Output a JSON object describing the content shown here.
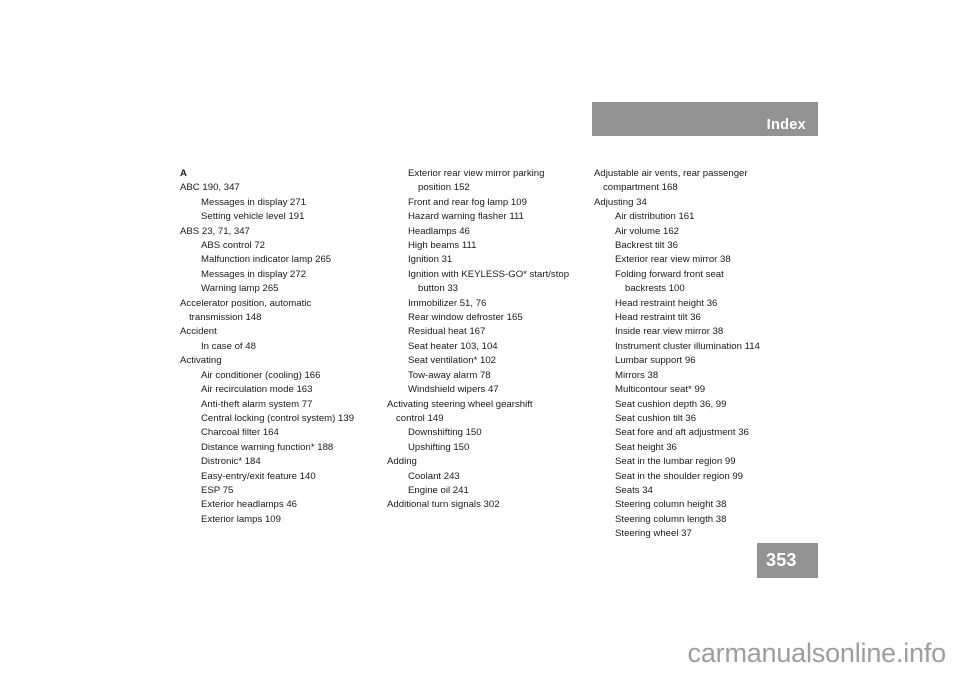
{
  "header": {
    "title": "Index"
  },
  "footer": {
    "page_number": "353",
    "watermark": "carmanualsonline.info"
  },
  "colors": {
    "band": "#939393",
    "band_text": "#ffffff",
    "body_text": "#1a1a1a",
    "watermark": "#9d9d9d",
    "page_background": "#ffffff"
  },
  "columns": [
    {
      "lines": [
        {
          "level": "heading",
          "text": "A"
        },
        {
          "level": 0,
          "text": "ABC    190, 347"
        },
        {
          "level": 1,
          "text": "Messages in display    271"
        },
        {
          "level": 1,
          "text": "Setting vehicle level    191"
        },
        {
          "level": 0,
          "text": "ABS    23, 71, 347"
        },
        {
          "level": 1,
          "text": "ABS control    72"
        },
        {
          "level": 1,
          "text": "Malfunction indicator lamp    265"
        },
        {
          "level": 1,
          "text": "Messages in display    272"
        },
        {
          "level": 1,
          "text": "Warning lamp    265"
        },
        {
          "level": 0,
          "text": "Accelerator position, automatic"
        },
        {
          "level": "0c",
          "text": "transmission    148"
        },
        {
          "level": 0,
          "text": "Accident"
        },
        {
          "level": 1,
          "text": "In case of    48"
        },
        {
          "level": 0,
          "text": "Activating"
        },
        {
          "level": 1,
          "text": "Air conditioner (cooling)    166"
        },
        {
          "level": 1,
          "text": "Air recirculation mode    163"
        },
        {
          "level": 1,
          "text": "Anti-theft alarm system    77"
        },
        {
          "level": 1,
          "text": "Central locking (control system)    139"
        },
        {
          "level": 1,
          "text": "Charcoal filter    164"
        },
        {
          "level": 1,
          "text": "Distance warning function*    188"
        },
        {
          "level": 1,
          "text": "Distronic*    184"
        },
        {
          "level": 1,
          "text": "Easy-entry/exit feature    140"
        },
        {
          "level": 1,
          "text": "ESP    75"
        },
        {
          "level": 1,
          "text": "Exterior headlamps    46"
        },
        {
          "level": 1,
          "text": "Exterior lamps    109"
        }
      ]
    },
    {
      "lines": [
        {
          "level": 1,
          "text": "Exterior rear view mirror parking"
        },
        {
          "level": "1c",
          "text": "position    152"
        },
        {
          "level": 1,
          "text": "Front and rear fog lamp    109"
        },
        {
          "level": 1,
          "text": "Hazard warning flasher    111"
        },
        {
          "level": 1,
          "text": "Headlamps    46"
        },
        {
          "level": 1,
          "text": "High beams    111"
        },
        {
          "level": 1,
          "text": "Ignition    31"
        },
        {
          "level": 1,
          "text": "Ignition with KEYLESS-GO* start/stop"
        },
        {
          "level": "1c",
          "text": "button    33"
        },
        {
          "level": 1,
          "text": "Immobilizer    51, 76"
        },
        {
          "level": 1,
          "text": "Rear window defroster    165"
        },
        {
          "level": 1,
          "text": "Residual heat    167"
        },
        {
          "level": 1,
          "text": "Seat heater    103, 104"
        },
        {
          "level": 1,
          "text": "Seat ventilation*    102"
        },
        {
          "level": 1,
          "text": "Tow-away alarm    78"
        },
        {
          "level": 1,
          "text": "Windshield wipers    47"
        },
        {
          "level": 0,
          "text": "Activating steering wheel gearshift"
        },
        {
          "level": "0c",
          "text": "control    149"
        },
        {
          "level": 1,
          "text": "Downshifting    150"
        },
        {
          "level": 1,
          "text": "Upshifting    150"
        },
        {
          "level": 0,
          "text": "Adding"
        },
        {
          "level": 1,
          "text": "Coolant    243"
        },
        {
          "level": 1,
          "text": "Engine oil    241"
        },
        {
          "level": 0,
          "text": "Additional turn signals    302"
        }
      ]
    },
    {
      "lines": [
        {
          "level": 0,
          "text": "Adjustable air vents, rear passenger"
        },
        {
          "level": "0c",
          "text": "compartment    168"
        },
        {
          "level": 0,
          "text": "Adjusting    34"
        },
        {
          "level": 1,
          "text": "Air distribution    161"
        },
        {
          "level": 1,
          "text": "Air volume    162"
        },
        {
          "level": 1,
          "text": "Backrest tilt    36"
        },
        {
          "level": 1,
          "text": "Exterior rear view mirror    38"
        },
        {
          "level": 1,
          "text": "Folding forward front seat"
        },
        {
          "level": "1c",
          "text": "backrests    100"
        },
        {
          "level": 1,
          "text": "Head restraint height    36"
        },
        {
          "level": 1,
          "text": "Head restraint tilt    36"
        },
        {
          "level": 1,
          "text": "Inside rear view mirror    38"
        },
        {
          "level": 1,
          "text": "Instrument cluster illumination    114"
        },
        {
          "level": 1,
          "text": "Lumbar support    96"
        },
        {
          "level": 1,
          "text": "Mirrors    38"
        },
        {
          "level": 1,
          "text": "Multicontour seat*    99"
        },
        {
          "level": 1,
          "text": "Seat cushion depth    36, 99"
        },
        {
          "level": 1,
          "text": "Seat cushion tilt    36"
        },
        {
          "level": 1,
          "text": "Seat fore and aft adjustment    36"
        },
        {
          "level": 1,
          "text": "Seat height    36"
        },
        {
          "level": 1,
          "text": "Seat in the lumbar region    99"
        },
        {
          "level": 1,
          "text": "Seat in the shoulder region    99"
        },
        {
          "level": 1,
          "text": "Seats    34"
        },
        {
          "level": 1,
          "text": "Steering column height    38"
        },
        {
          "level": 1,
          "text": "Steering column length    38"
        },
        {
          "level": 1,
          "text": "Steering wheel    37"
        }
      ]
    }
  ]
}
